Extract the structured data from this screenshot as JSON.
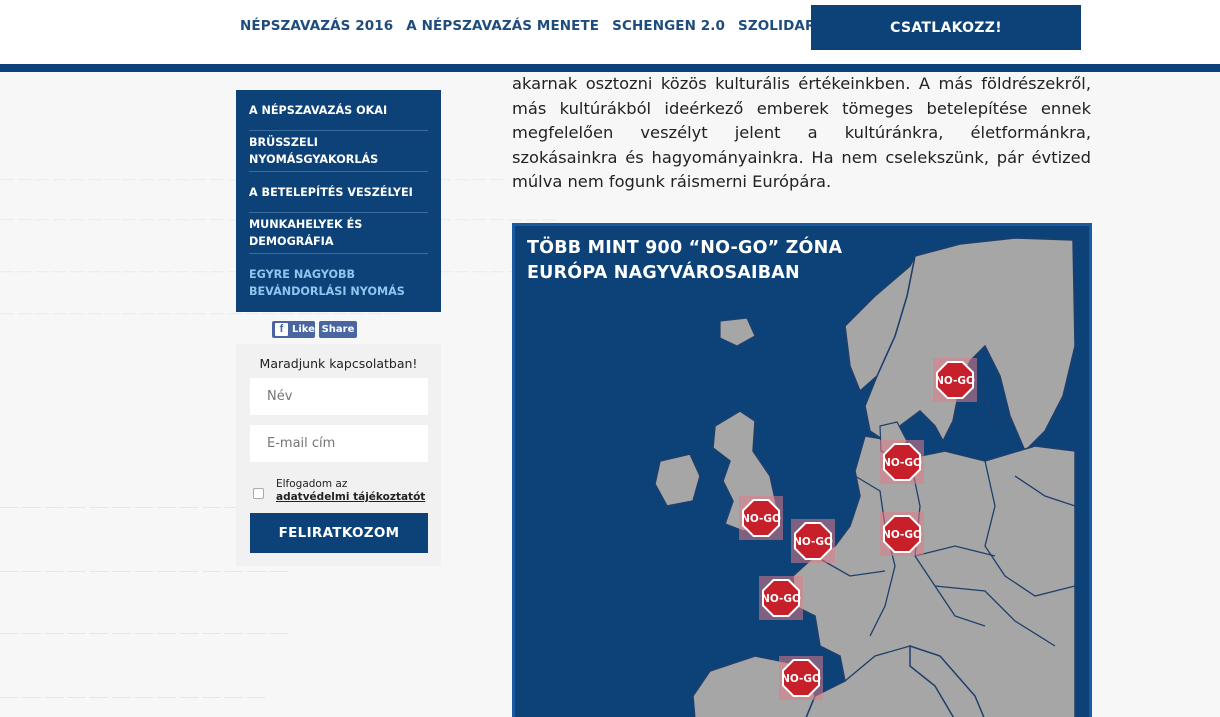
{
  "nav": {
    "items": [
      "NÉPSZAVAZÁS 2016",
      "A NÉPSZAVAZÁS MENETE",
      "SCHENGEN 2.0",
      "SZOLIDARITÁS"
    ],
    "cta": "CSATLAKOZZ!"
  },
  "sidebar": {
    "items": [
      "A NÉPSZAVAZÁS OKAI",
      "BRÜSSZELI NYOMÁSGYAKORLÁS",
      "A BETELEPÍTÉS VESZÉLYEI",
      "MUNKAHELYEK ÉS DEMOGRÁFIA",
      "EGYRE NAGYOBB BEVÁNDORLÁSI NYOMÁS"
    ],
    "facebook": {
      "like": "Like",
      "share": "Share"
    }
  },
  "newsletter": {
    "title": "Maradjunk kapcsolatban!",
    "name_placeholder": "Név",
    "email_placeholder": "E-mail cím",
    "agree_prefix": "Elfogadom az",
    "agree_link": "adatvédelmi tájékoztatót",
    "submit": "FELIRATKOZOM"
  },
  "article": {
    "text": "akarnak osztozni közös kulturális értékeinkben. A más földrészekről, más kultúrákból ideérkező emberek tömeges betelepítése ennek megfelelően veszélyt jelent a kultúránkra, életformánkra, szokásainkra és hagyományainkra. Ha nem cselekszünk, pár évtized múlva nem fogunk ráismerni Európára."
  },
  "map": {
    "title_line1": "TÖBB MINT 900 “NO-GO” ZÓNA",
    "title_line2": "EURÓPA NAGYVÁROSAIBAN",
    "sign_label": "NO-GO",
    "colors": {
      "sea": "#0c4278",
      "land": "#a6a6a6",
      "border": "#1f3f6b",
      "sign": "#c8202a"
    }
  },
  "colors": {
    "primary": "#0c4278",
    "accent_light": "#8fc6ef"
  }
}
